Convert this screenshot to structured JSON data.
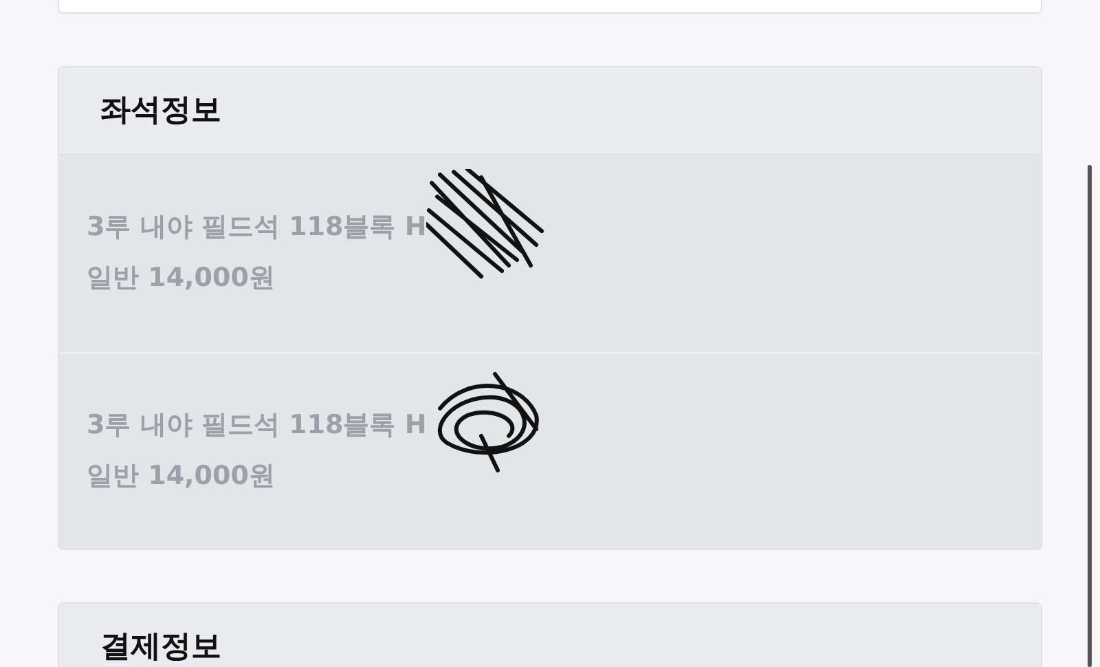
{
  "sections": [
    {
      "title": "좌석정보",
      "rows": [
        {
          "seat": "3루 내야 필드석 118블록 H",
          "price": "일반 14,000원",
          "redacted": true
        },
        {
          "seat": "3루 내야 필드석 118블록 H",
          "price": "일반 14,000원",
          "redacted": true
        }
      ]
    },
    {
      "title": "결제정보"
    }
  ]
}
